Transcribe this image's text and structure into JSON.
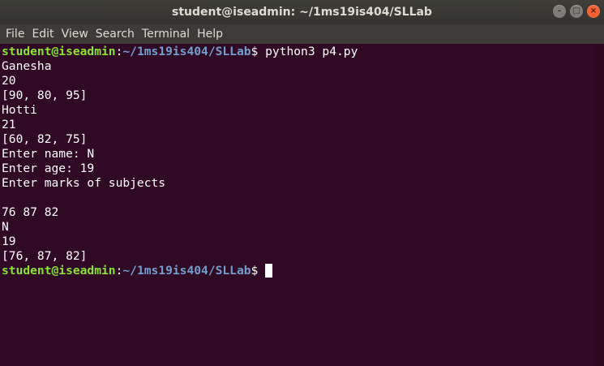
{
  "window": {
    "title": "student@iseadmin: ~/1ms19is404/SLLab",
    "buttons": {
      "minimize": "–",
      "maximize": "□",
      "close": "×"
    }
  },
  "menu": [
    "File",
    "Edit",
    "View",
    "Search",
    "Terminal",
    "Help"
  ],
  "prompt": {
    "user_host": "student@iseadmin",
    "sep": ":",
    "path": "~/1ms19is404/SLLab",
    "symbol": "$"
  },
  "command": " python3 p4.py",
  "output": [
    "Ganesha",
    "20",
    "[90, 80, 95]",
    "Hotti",
    "21",
    "[60, 82, 75]",
    "Enter name: N",
    "Enter age: 19",
    "Enter marks of subjects",
    "",
    "76 87 82",
    "N",
    "19",
    "[76, 87, 82]"
  ],
  "colors": {
    "background": "#300a24",
    "user": "#8ae234",
    "path": "#729fcf",
    "text": "#ffffff"
  }
}
